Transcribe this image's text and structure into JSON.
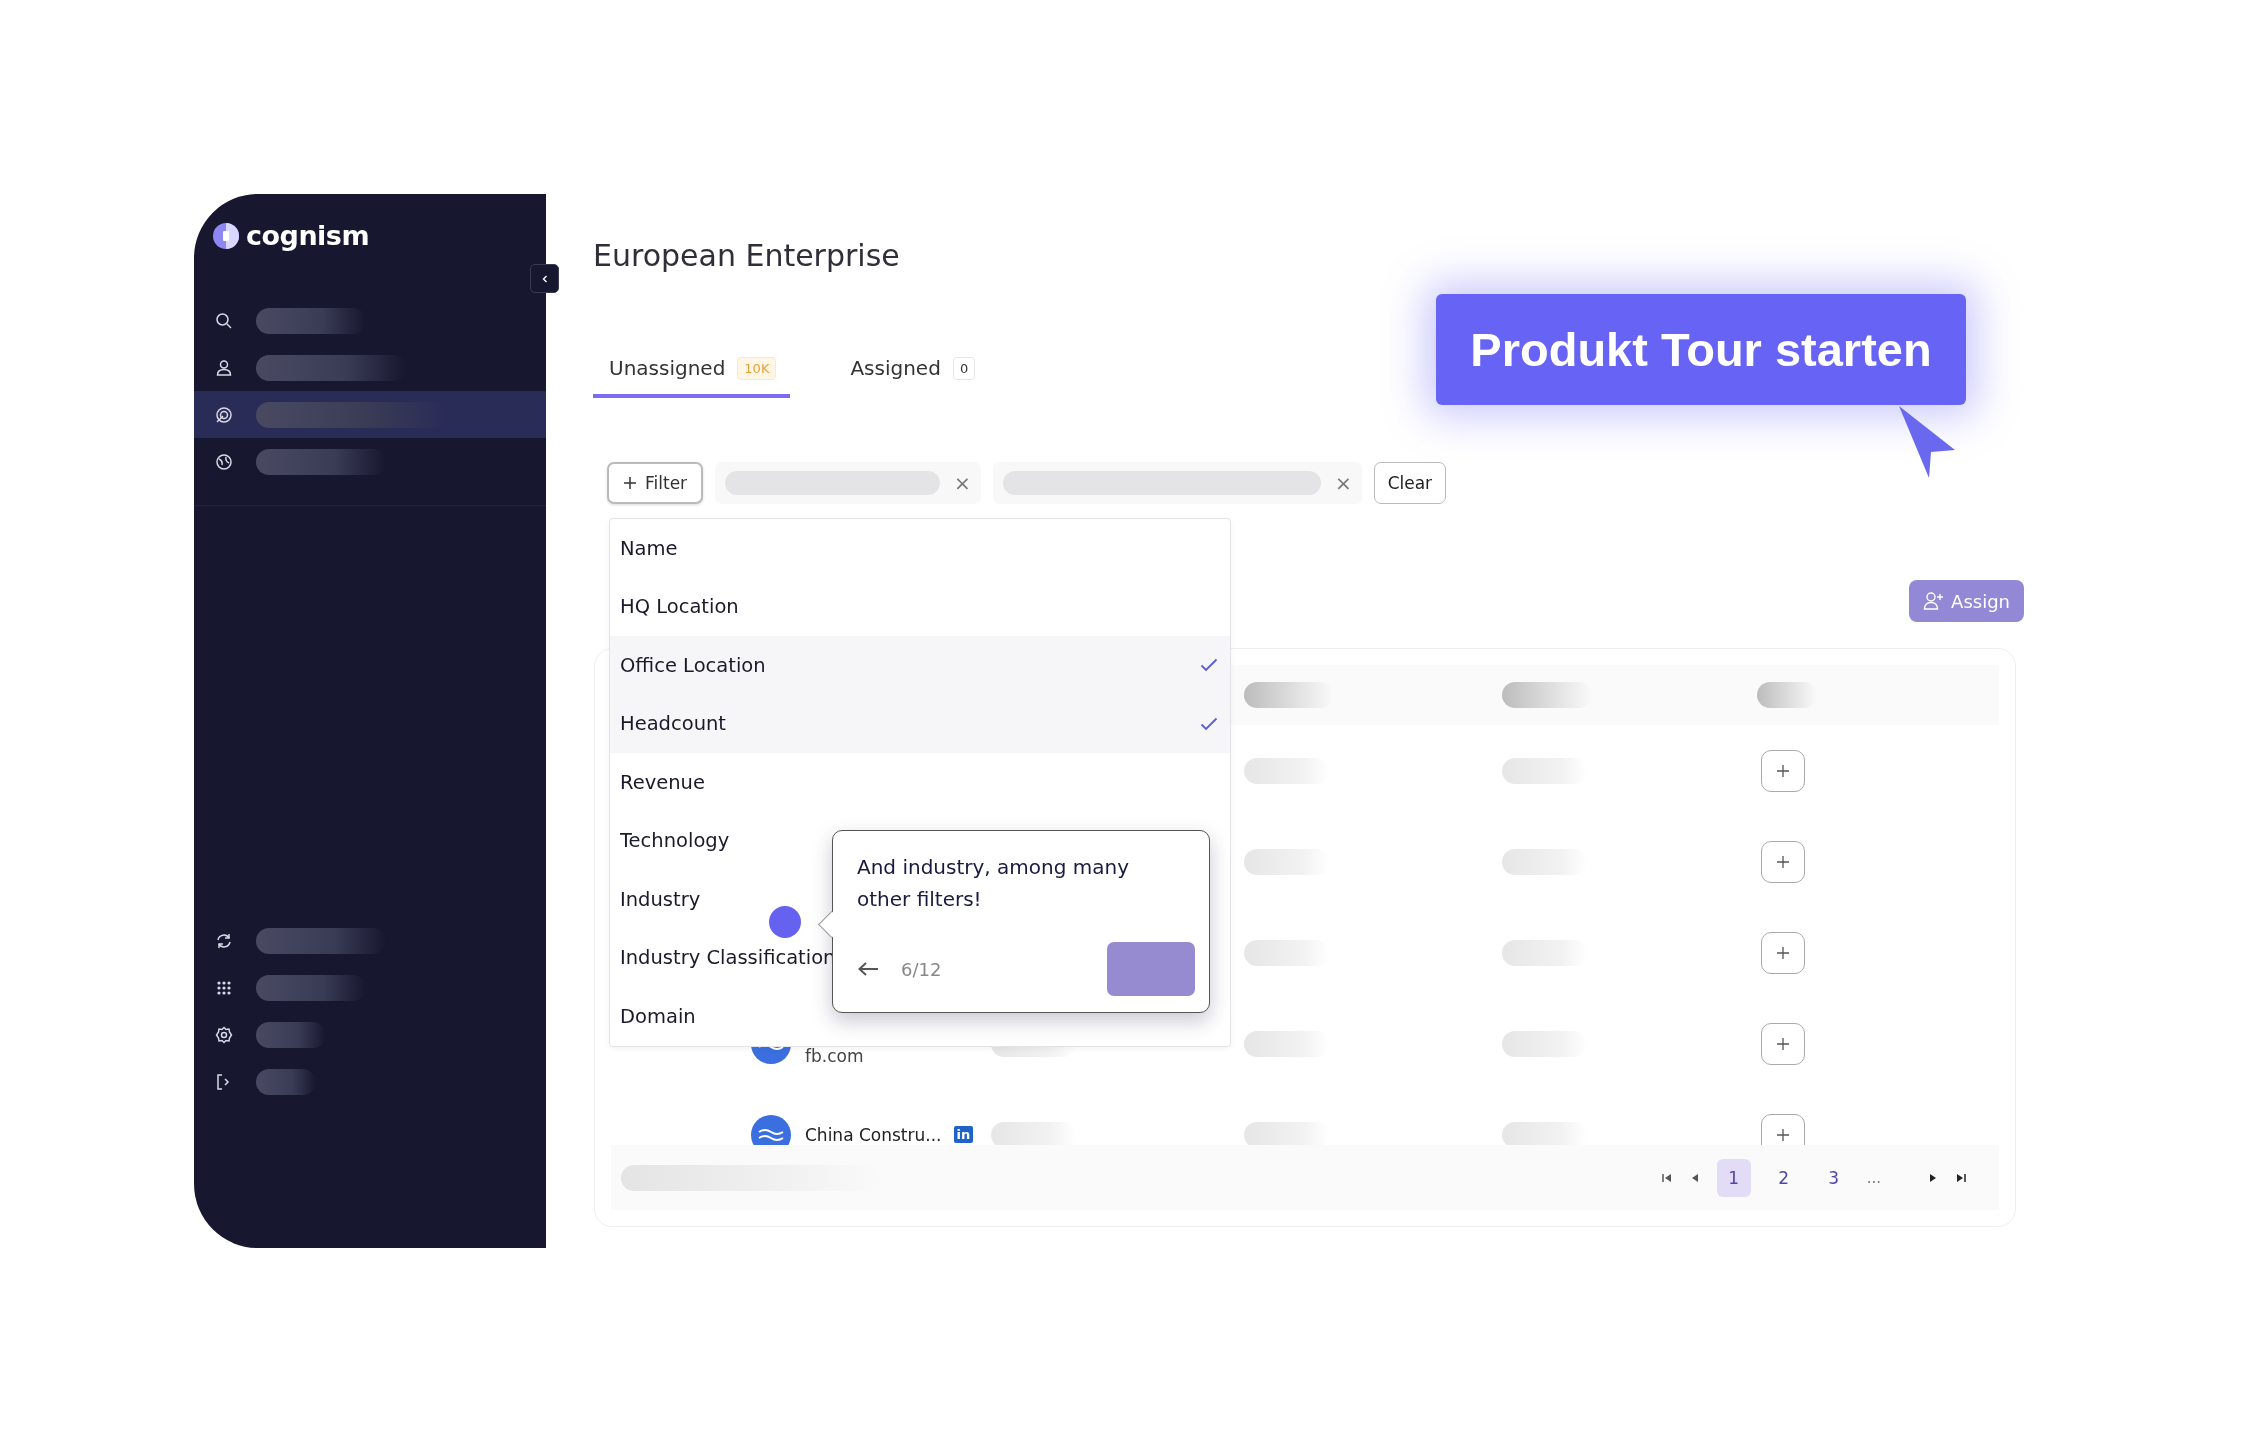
{
  "brand": {
    "name": "cognism"
  },
  "sidebar": {
    "top_items": [
      {
        "selected": false
      },
      {
        "selected": false
      },
      {
        "selected": true
      },
      {
        "selected": false
      }
    ],
    "bottom_items": [
      {
        "selected": false
      },
      {
        "selected": false
      },
      {
        "selected": false
      },
      {
        "selected": false
      }
    ]
  },
  "title": "European Enterprise",
  "tabs": [
    {
      "label": "Unassigned",
      "count": "10K",
      "selected": true
    },
    {
      "label": "Assigned",
      "count": "0",
      "selected": false
    }
  ],
  "tour_button": "Produkt Tour starten",
  "filter_bar": {
    "filter_button": "Filter",
    "chips": [
      {
        "remove": "×"
      },
      {
        "remove": "×"
      }
    ],
    "clear_button": "Clear"
  },
  "filter_menu": {
    "items": [
      {
        "label": "Name",
        "checked": false
      },
      {
        "label": "HQ Location",
        "checked": false
      },
      {
        "label": "Office Location",
        "checked": true
      },
      {
        "label": "Headcount",
        "checked": true
      },
      {
        "label": "Revenue",
        "checked": false
      },
      {
        "label": "Technology",
        "checked": false
      },
      {
        "label": "Industry",
        "checked": false
      },
      {
        "label": "Industry Classification",
        "checked": false
      },
      {
        "label": "Domain",
        "checked": false
      }
    ]
  },
  "tooltip": {
    "text": "And industry, among many other filters!",
    "step": "6/12"
  },
  "assign_button": "Assign",
  "table": {
    "rows": [
      {
        "kind": "blurred"
      },
      {
        "kind": "blurred"
      },
      {
        "kind": "blurred"
      },
      {
        "kind": "company",
        "domain": "fb.com"
      },
      {
        "kind": "company",
        "name": "China Constru...",
        "linkedin": "in"
      }
    ]
  },
  "pagination": {
    "pages": [
      {
        "label": "1",
        "selected": true
      },
      {
        "label": "2",
        "selected": false
      },
      {
        "label": "3",
        "selected": false
      }
    ],
    "ellipsis": "..."
  }
}
